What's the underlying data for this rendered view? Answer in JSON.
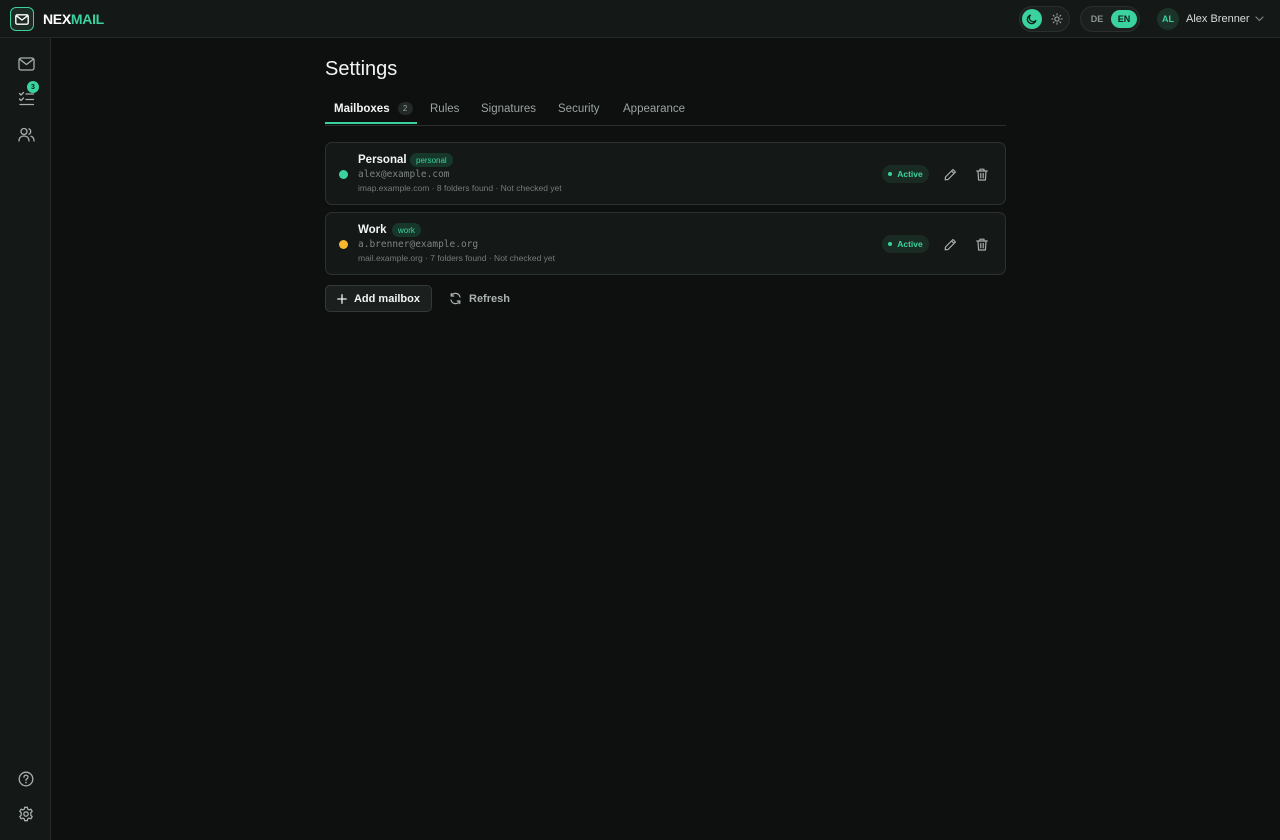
{
  "app": {
    "brand_part1": "NEX",
    "brand_part2": "MAIL",
    "accent_color": "#3ad29f"
  },
  "header": {
    "theme": {
      "options": [
        "moon-icon",
        "sun-icon"
      ],
      "selected": "dark"
    },
    "language": {
      "options": [
        "DE",
        "EN"
      ],
      "selected": "EN"
    },
    "user": {
      "initials": "AL",
      "name": "Alex Brenner"
    }
  },
  "sidebar": {
    "items": [
      {
        "icon": "mail-icon"
      },
      {
        "icon": "tasks-icon",
        "badge": "3"
      },
      {
        "icon": "contacts-icon"
      }
    ],
    "bottom_items": [
      {
        "icon": "help-icon"
      },
      {
        "icon": "gear-icon"
      }
    ]
  },
  "page": {
    "title": "Settings",
    "tabs": [
      {
        "label": "Mailboxes",
        "count": "2",
        "active": true
      },
      {
        "label": "Rules"
      },
      {
        "label": "Signatures"
      },
      {
        "label": "Security"
      },
      {
        "label": "Appearance"
      }
    ]
  },
  "mailboxes": [
    {
      "name": "Personal",
      "tag": "personal",
      "email": "alex@example.com",
      "meta": "imap.example.com · 8 folders found · Not checked yet",
      "status": "Active",
      "dot_color": "#3ad29f"
    },
    {
      "name": "Work",
      "tag": "work",
      "email": "a.brenner@example.org",
      "meta": "mail.example.org · 7 folders found · Not checked yet",
      "status": "Active",
      "dot_color": "#f5b82e"
    }
  ],
  "actions": {
    "add_label": "Add mailbox",
    "refresh_label": "Refresh"
  }
}
